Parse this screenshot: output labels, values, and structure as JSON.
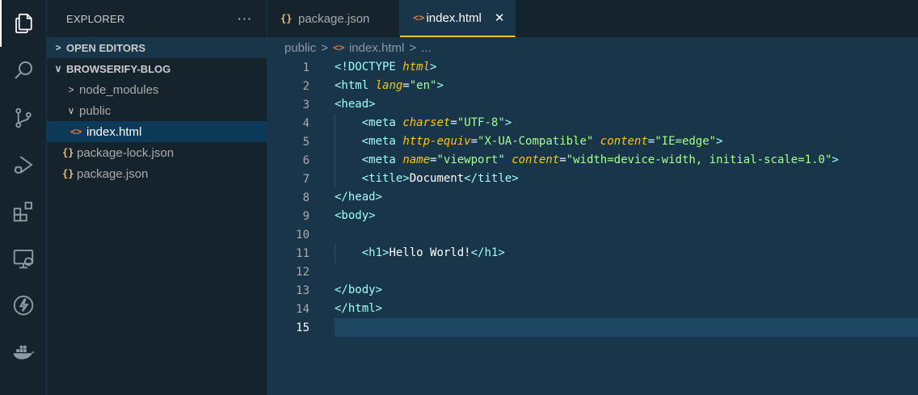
{
  "activity_bar": {
    "items": [
      {
        "icon": "files-icon",
        "active": true
      },
      {
        "icon": "search-icon"
      },
      {
        "icon": "source-control-icon"
      },
      {
        "icon": "run-debug-icon"
      },
      {
        "icon": "extensions-icon"
      },
      {
        "icon": "remote-explorer-icon"
      },
      {
        "icon": "lightning-icon"
      },
      {
        "icon": "docker-icon"
      }
    ]
  },
  "sidebar": {
    "title": "EXPLORER",
    "more": "···",
    "open_editors_label": "OPEN EDITORS",
    "project_label": "BROWSERIFY-BLOG",
    "tree": [
      {
        "label": "node_modules",
        "type": "folder",
        "expanded": false
      },
      {
        "label": "public",
        "type": "folder",
        "expanded": true
      },
      {
        "label": "index.html",
        "type": "html",
        "selected": true
      },
      {
        "label": "package-lock.json",
        "type": "json"
      },
      {
        "label": "package.json",
        "type": "json"
      }
    ]
  },
  "editor": {
    "tabs": [
      {
        "label": "package.json",
        "icon": "{}",
        "active": false
      },
      {
        "label": "index.html",
        "icon": "<>",
        "active": true,
        "close": "✕"
      }
    ],
    "breadcrumb": {
      "folder": "public",
      "sep": ">",
      "file": "index.html",
      "more": "..."
    },
    "current_line": 15,
    "lines": [
      "<!DOCTYPE html>",
      "<html lang=\"en\">",
      "<head>",
      "    <meta charset=\"UTF-8\">",
      "    <meta http-equiv=\"X-UA-Compatible\" content=\"IE=edge\">",
      "    <meta name=\"viewport\" content=\"width=device-width, initial-scale=1.0\">",
      "    <title>Document</title>",
      "</head>",
      "<body>",
      "",
      "    <h1>Hello World!</h1>",
      "",
      "</body>",
      "</html>",
      ""
    ]
  },
  "colors": {
    "background": "#193549",
    "sidebar": "#15232d",
    "accent": "#ffc600",
    "tag": "#9effff",
    "string": "#a5ff90"
  }
}
